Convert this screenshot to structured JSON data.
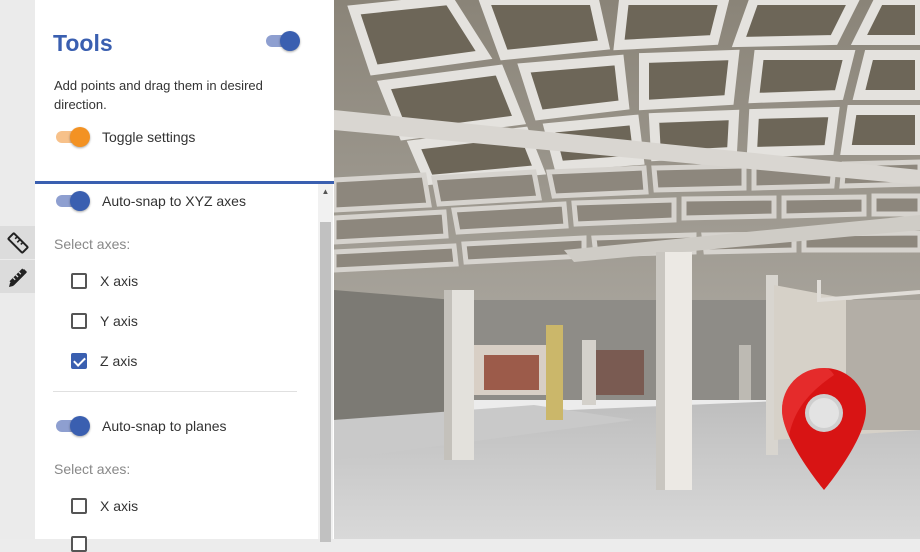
{
  "panel": {
    "title": "Tools",
    "description": "Add points and drag them in desired direction.",
    "toggle_settings_label": "Toggle settings",
    "xyz_snap_label": "Auto-snap to XYZ axes",
    "select_axes_label": "Select axes:",
    "xyz_axes": [
      {
        "label": "X axis",
        "checked": false
      },
      {
        "label": "Y axis",
        "checked": false
      },
      {
        "label": "Z axis",
        "checked": true
      }
    ],
    "planes_snap_label": "Auto-snap to planes",
    "planes_axes": [
      {
        "label": "X axis",
        "checked": false
      }
    ]
  },
  "rail": {
    "icons": [
      "ruler-icon",
      "drafting-tools-icon"
    ]
  },
  "colors": {
    "accent": "#3a5fb0",
    "orange": "#f39223",
    "pin": "#d81414"
  }
}
